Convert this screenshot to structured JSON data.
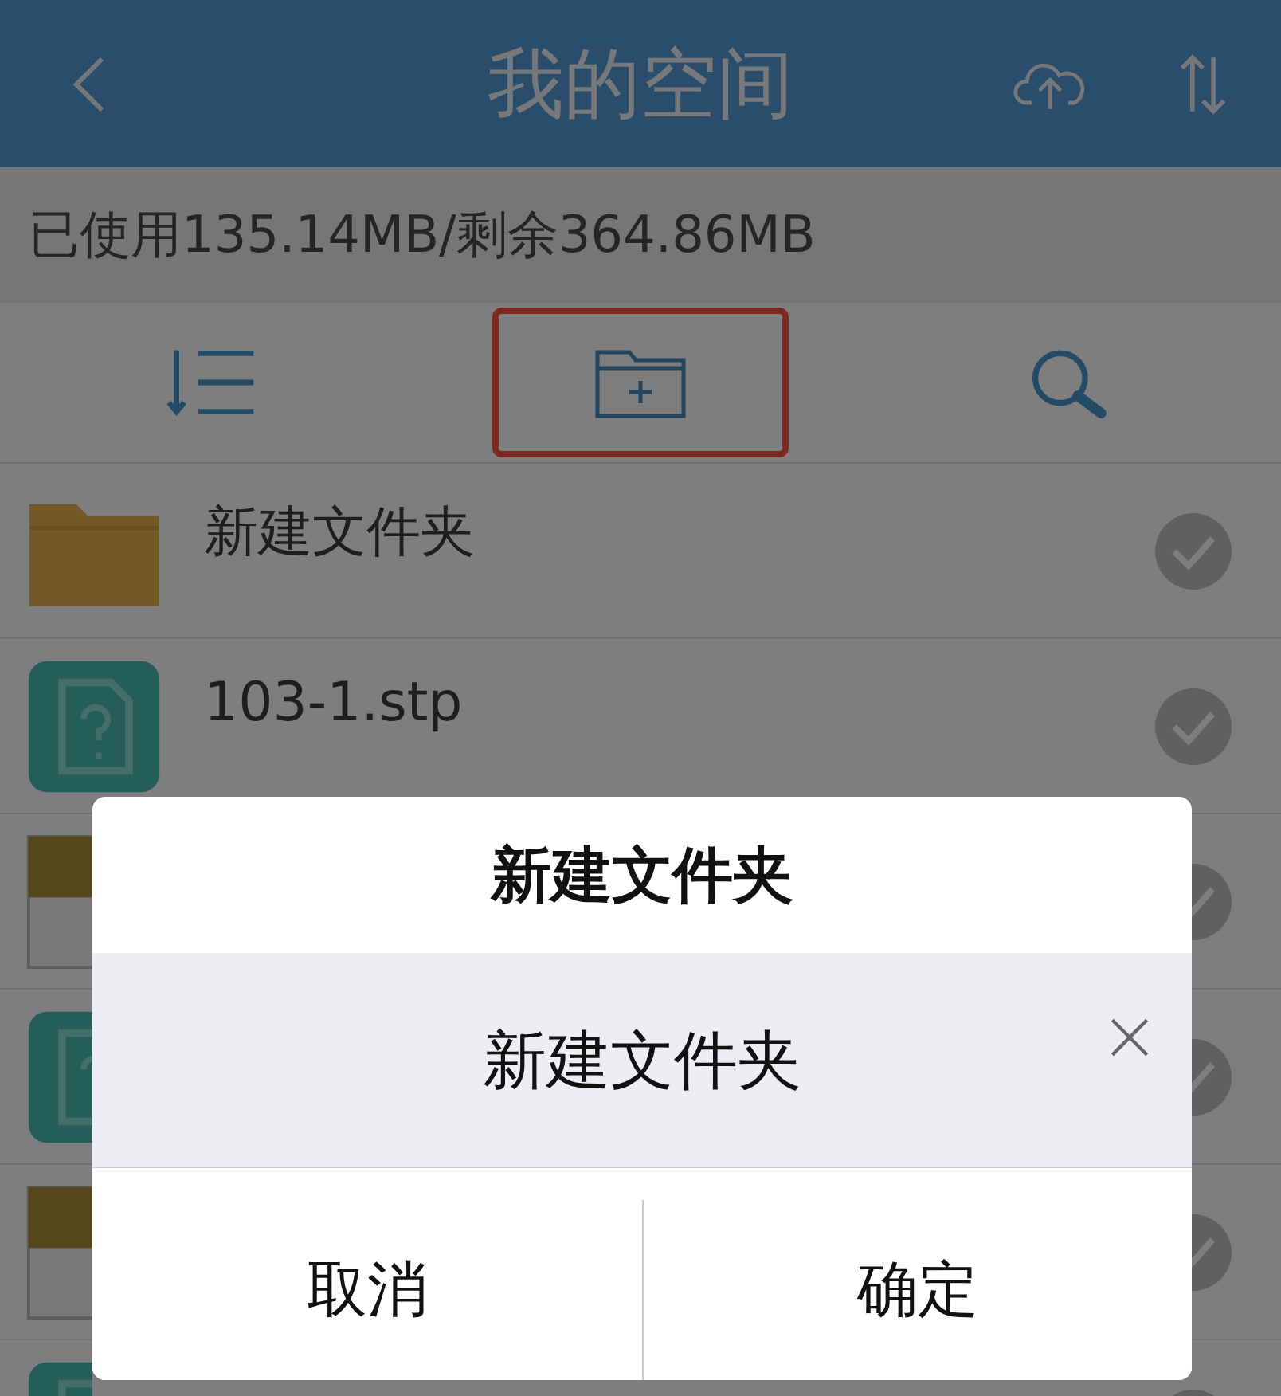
{
  "header": {
    "title": "我的空间"
  },
  "storage": {
    "text": "已使用135.14MB/剩余364.86MB"
  },
  "toolbar": {
    "new_folder": {
      "highlighted": true
    }
  },
  "files": [
    {
      "kind": "folder",
      "name": "新建文件夹"
    },
    {
      "kind": "unknown",
      "name": "103-1.stp"
    },
    {
      "kind": "stp"
    },
    {
      "kind": "unknown"
    },
    {
      "kind": "stp"
    },
    {
      "kind": "unknown"
    }
  ],
  "dialog": {
    "title": "新建文件夹",
    "input": {
      "value": "新建文件夹"
    },
    "buttons": [
      "取消",
      "确定"
    ]
  }
}
